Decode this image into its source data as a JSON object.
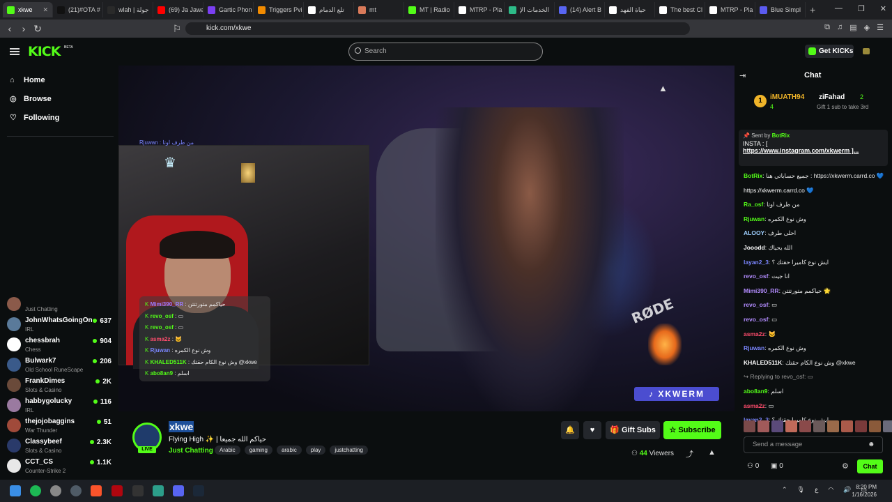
{
  "browser": {
    "tabs": [
      {
        "label": "xkwe",
        "color": "#53fc18"
      },
      {
        "label": "(21)#OTA #",
        "color": "#111111"
      },
      {
        "label": "wlah | جولة",
        "color": "#2a2a2a"
      },
      {
        "label": "(69) Ja Jawa",
        "color": "#ff0000"
      },
      {
        "label": "Gartic Phon",
        "color": "#7b3ff2"
      },
      {
        "label": "Triggers Pvi",
        "color": "#f28b00"
      },
      {
        "label": "تلع الدمام",
        "color": "#ffffff"
      },
      {
        "label": "mt",
        "color": "#d97a5a"
      },
      {
        "label": "MT | Radio",
        "color": "#53fc18"
      },
      {
        "label": "MTRP - Pla",
        "color": "#ffffff"
      },
      {
        "label": "الخدمات الإ",
        "color": "#2dbb88"
      },
      {
        "label": "(14) Alert B",
        "color": "#5865f2"
      },
      {
        "label": "حياة الفهد",
        "color": "#ffffff"
      },
      {
        "label": "The best Cl",
        "color": "#ffffff"
      },
      {
        "label": "MTRP - Pla",
        "color": "#ffffff"
      },
      {
        "label": "Blue Simpl",
        "color": "#5b5bf0"
      }
    ],
    "url": "kick.com/xkwe"
  },
  "header": {
    "logo": "KICK",
    "beta": "BETA",
    "search_placeholder": "Search",
    "get_kicks": "Get KICKs"
  },
  "sidebar": {
    "nav": [
      "Home",
      "Browse",
      "Following"
    ],
    "following": [
      {
        "name": "",
        "category": "Just Chatting",
        "viewers": "",
        "color": "#8b5a4a"
      },
      {
        "name": "JohnWhatsGoingOn",
        "category": "IRL",
        "viewers": "637",
        "color": "#5a7a9a"
      },
      {
        "name": "chessbrah",
        "category": "Chess",
        "viewers": "904",
        "color": "#ffffff"
      },
      {
        "name": "Bulwark7",
        "category": "Old School RuneScape",
        "viewers": "206",
        "color": "#3a5a8a"
      },
      {
        "name": "FrankDimes",
        "category": "Slots & Casino",
        "viewers": "2K",
        "color": "#6a4a3a"
      },
      {
        "name": "habbygolucky",
        "category": "IRL",
        "viewers": "116",
        "color": "#9a7aa0"
      },
      {
        "name": "thejojobaggins",
        "category": "War Thunder",
        "viewers": "51",
        "color": "#a04a3a"
      },
      {
        "name": "Classybeef",
        "category": "Slots & Casino",
        "viewers": "2.3K",
        "color": "#2a3a6a"
      },
      {
        "name": "CCT_CS",
        "category": "Counter-Strike 2",
        "viewers": "1.1K",
        "color": "#e8e8e8"
      }
    ]
  },
  "overlay_chat": [
    {
      "user": "Mimi390_RR",
      "text": "حياكمم متورتتتن",
      "color": "#9b7bff"
    },
    {
      "user": "revo_osf",
      "text": "▭",
      "color": "#53fc18"
    },
    {
      "user": "revo_osf",
      "text": "▭",
      "color": "#53fc18"
    },
    {
      "user": "asma2z",
      "text": "🐱",
      "color": "#ff4d6d"
    },
    {
      "user": "Rjuwan",
      "text": "وش نوع الكمره",
      "color": "#7b86ff"
    },
    {
      "user": "KHALED511K",
      "text": "وش نوع الكام حقتك @xkwe",
      "color": "#53fc18"
    },
    {
      "user": "abo8an9",
      "text": "اسلم",
      "color": "#53fc18"
    }
  ],
  "overlay_top": "Rjuwan : من طرف اوتا",
  "video_text": {
    "tiktok": "XKWERM",
    "mic_brand": "RØDE"
  },
  "stream": {
    "channel": "xkwe",
    "title": "Flying High ✨ | حياكم الله جميعا",
    "category": "Just Chatting",
    "tags": [
      "Arabic",
      "gaming",
      "arabic",
      "play",
      "justchatting"
    ],
    "viewers_count": "44",
    "viewers_label": "Viewers",
    "live": "LIVE",
    "gift_subs": "Gift Subs",
    "subscribe": "Subscribe"
  },
  "chat": {
    "title": "Chat",
    "leaderboard": {
      "first_user": "iMUATH94",
      "first_count": "4",
      "second_user": "ziFahad",
      "second_count": "2",
      "note": "Gift 1 sub to take 3rd"
    },
    "pinned": {
      "sent_by_label": "Sent by",
      "sender": "BotRix",
      "line1": "INSTA : [",
      "line2": "https://www.instagram.com/xkwerm ]..."
    },
    "messages": [
      {
        "user": "BotRix",
        "text": "جميع حساباتي هنا : https://xkwerm.carrd.co 💙",
        "color": "#53fc18"
      },
      {
        "user": "",
        "text": "https://xkwerm.carrd.co 💙",
        "color": "#ffffff"
      },
      {
        "user": "Ra_osf",
        "text": "من طرف اوتا",
        "color": "#53fc18"
      },
      {
        "user": "Rjuwan",
        "text": "وش نوع الكمره",
        "color": "#53fc18"
      },
      {
        "user": "ALOOY",
        "text": "احلى طرف",
        "color": "#9fd0ff"
      },
      {
        "user": "Jooodd",
        "text": "الله يحياك",
        "color": "#ffffff"
      },
      {
        "user": "layan2_3",
        "text": "ايش نوع كاميرا حقتك ؟",
        "color": "#7b86ff"
      },
      {
        "user": "revo_osf",
        "text": "انا جيت",
        "color": "#b38cff"
      },
      {
        "user": "Mimi390_RR",
        "text": "حياكمم متورتتتن 🌟",
        "color": "#b38cff"
      },
      {
        "user": "revo_osf",
        "text": "▭",
        "color": "#b38cff"
      },
      {
        "user": "revo_osf",
        "text": "▭",
        "color": "#b38cff"
      },
      {
        "user": "asma2z",
        "text": "🐱",
        "color": "#ff4d6d"
      },
      {
        "user": "Rjuwan",
        "text": "وش نوع الكمره",
        "color": "#7b86ff"
      },
      {
        "user": "KHALED511K",
        "text": "وش نوع الكام حقتك @xkwe",
        "color": "#ffffff"
      },
      {
        "user": "",
        "text": "↪ Replying to revo_osf: ▭",
        "color": "#999999"
      },
      {
        "user": "abo8an9",
        "text": "اسلم",
        "color": "#53fc18"
      },
      {
        "user": "asma2z",
        "text": "▭",
        "color": "#ff4d6d"
      },
      {
        "user": "layan2_3",
        "text": "ايش نوع كاميرا حقتك ؟",
        "color": "#7b86ff"
      }
    ],
    "send_placeholder": "Send a message",
    "kicks": "0",
    "subs": "0",
    "chat_button": "Chat"
  },
  "taskbar": {
    "time": "8:20 PM",
    "date": "1/16/2026",
    "lang": "ع"
  }
}
